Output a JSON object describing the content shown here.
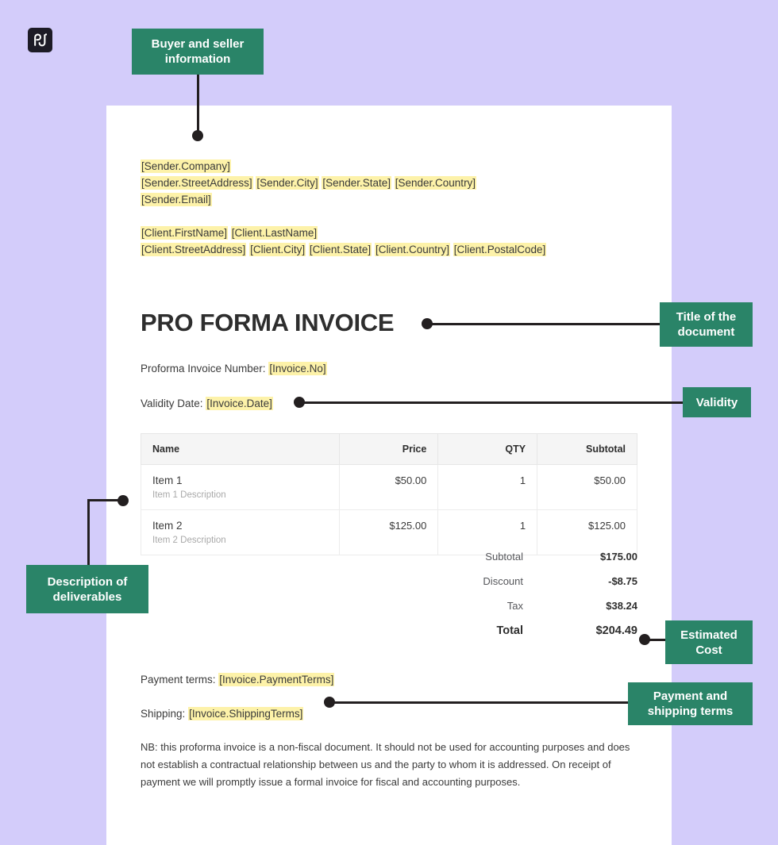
{
  "brand": {
    "logo_icon": "pandadoc-logo-icon",
    "logo_text": "pd"
  },
  "document": {
    "title": "PRO FORMA INVOICE",
    "sender_lines": [
      [
        "[Sender.Company]"
      ],
      [
        "[Sender.StreetAddress]",
        "[Sender.City]",
        "[Sender.State]",
        "[Sender.Country]"
      ],
      [
        "[Sender.Email]"
      ]
    ],
    "client_lines": [
      [
        "[Client.FirstName]",
        "[Client.LastName]"
      ],
      [
        "[Client.StreetAddress]",
        "[Client.City]",
        "[Client.State]",
        "[Client.Country]",
        "[Client.PostalCode]"
      ]
    ],
    "meta": {
      "invoice_number_label": "Proforma Invoice Number:",
      "invoice_number_value": "[Invoice.No]",
      "validity_label": "Validity Date:",
      "validity_value": "[Invoice.Date]"
    },
    "table": {
      "headers": [
        "Name",
        "Price",
        "QTY",
        "Subtotal"
      ],
      "rows": [
        {
          "name": "Item 1",
          "description": "Item 1 Description",
          "price": "$50.00",
          "qty": "1",
          "subtotal": "$50.00"
        },
        {
          "name": "Item 2",
          "description": "Item 2 Description",
          "price": "$125.00",
          "qty": "1",
          "subtotal": "$125.00"
        }
      ]
    },
    "totals": [
      {
        "label": "Subtotal",
        "value": "$175.00"
      },
      {
        "label": "Discount",
        "value": "-$8.75"
      },
      {
        "label": "Tax",
        "value": "$38.24"
      },
      {
        "label": "Total",
        "value": "$204.49"
      }
    ],
    "terms": {
      "payment_label": "Payment terms:",
      "payment_value": "[Invoice.PaymentTerms]",
      "shipping_label": "Shipping:",
      "shipping_value": "[Invoice.ShippingTerms]"
    },
    "note": "NB: this proforma invoice is a non-fiscal document. It should not be used for accounting purposes and does not establish a contractual relationship between us and the party to whom it is addressed. On receipt of payment we will promptly issue a formal invoice for fiscal and accounting purposes."
  },
  "callouts": {
    "parties": "Buyer and seller information",
    "title": "Title of the document",
    "validity": "Validity",
    "deliverables": "Description of deliverables",
    "cost": "Estimated Cost",
    "terms": "Payment and shipping terms"
  },
  "colors": {
    "background": "#d3ccfa",
    "callout_green": "#2a8468",
    "highlight_yellow": "#fdf2a9",
    "leader_black": "#231f20",
    "page_white": "#ffffff"
  }
}
